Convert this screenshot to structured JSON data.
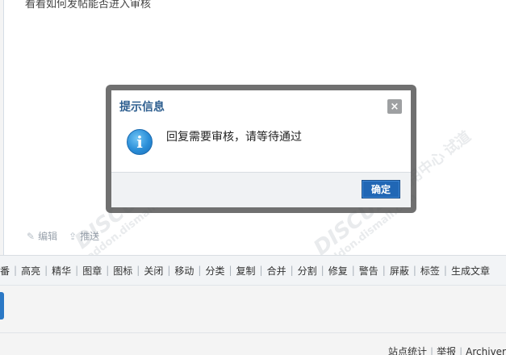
{
  "post": {
    "text": "看看如何发帖能否进入审核",
    "actions": [
      {
        "label": "编辑",
        "icon": "pencil-icon"
      },
      {
        "label": "推送",
        "icon": "push-icon"
      }
    ]
  },
  "moderation": {
    "items": [
      "番",
      "高亮",
      "精华",
      "图章",
      "图标",
      "关闭",
      "移动",
      "分类",
      "复制",
      "合并",
      "分割",
      "修复",
      "警告",
      "屏蔽",
      "标签",
      "生成文章"
    ]
  },
  "footer": {
    "links": [
      "站点统计",
      "举报",
      "Archiver"
    ]
  },
  "watermarks": {
    "brand": "DISCUZ!",
    "brand_cn": "应用中心",
    "site": "addon.dismall.com",
    "suffix": "试道"
  },
  "dialog": {
    "title": "提示信息",
    "message": "回复需要审核，请等待通过",
    "ok_label": "确定",
    "close_label": "×",
    "icon": "info-icon"
  },
  "colors": {
    "title": "#2d5e8f",
    "ok_button": "#2167b5",
    "info_icon": "#2a8ed8"
  }
}
